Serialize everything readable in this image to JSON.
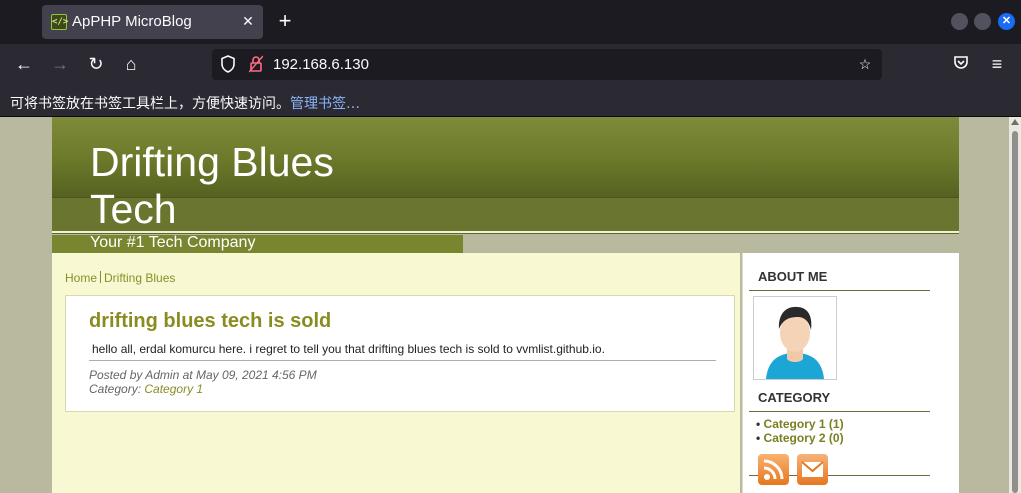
{
  "browser": {
    "tab_title": "ApPHP MicroBlog",
    "url": "192.168.6.130",
    "bookmark_prompt": "可将书签放在书签工具栏上，方便快速访问。",
    "bookmark_manage": "管理书签…"
  },
  "site": {
    "title_line1": "Drifting Blues",
    "title_line2": "Tech",
    "slogan": "Your #1 Tech Company"
  },
  "breadcrumb": {
    "home": "Home",
    "current": "Drifting Blues"
  },
  "post": {
    "title": "drifting blues tech is sold",
    "body": "hello all, erdal komurcu here. i regret to tell you that drifting blues tech is sold to vvmlist.github.io.",
    "posted_by": "Posted by Admin at May 09, 2021 4:56 PM",
    "category_prefix": "Category:",
    "category_link": "Category 1"
  },
  "sidebar": {
    "about_heading": "ABOUT ME",
    "category_heading": "CATEGORY",
    "categories": [
      {
        "name": "Category 1",
        "count": "(1)"
      },
      {
        "name": "Category 2",
        "count": "(0)"
      }
    ]
  },
  "colors": {
    "accent": "#8a8c22",
    "header_green": "#6c7a2b",
    "content_bg": "#f8f8d2"
  },
  "icons": [
    "favicon",
    "close-icon",
    "plus-icon",
    "back-icon",
    "forward-icon",
    "reload-icon",
    "home-icon",
    "shield-icon",
    "lock-icon",
    "star-icon",
    "pocket-icon",
    "menu-icon",
    "rss-icon",
    "mail-icon"
  ]
}
